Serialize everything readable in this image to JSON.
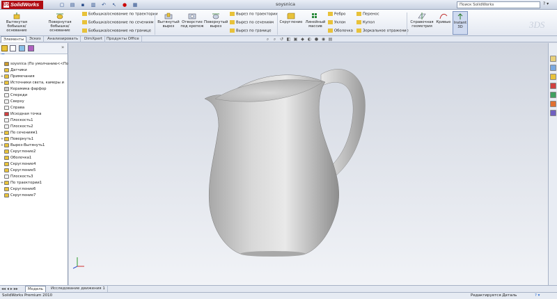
{
  "app": {
    "logo_text": "SolidWorks",
    "doc_title": "soysnica",
    "search_placeholder": "Поиск SolidWorks"
  },
  "ribbon": {
    "extrude_boss": "Вытянутая бобышка/основание",
    "revolve_boss": "Повернутая бобышка/основание",
    "sweep_boss": "Бобышка/основание по траектории",
    "loft_boss": "Бобышка/основание по сечениям",
    "boundary_boss": "Бобышка/основание на границе",
    "extrude_cut": "Вытянутый вырез",
    "hole_wizard": "Отверстие под крепеж",
    "revolve_cut": "Повернутый вырез",
    "sweep_cut": "Вырез по траектории",
    "loft_cut": "Вырез по сечениям",
    "boundary_cut": "Вырез по границе",
    "fillet": "Скругление",
    "linear_pattern": "Линейный массив",
    "rib": "Ребро",
    "draft": "Уклон",
    "shell": "Оболочка",
    "wrap": "Перенос",
    "dome": "Купол",
    "mirror": "Зеркальное отражение",
    "ref_geometry": "Справочная геометрия",
    "curves": "Кривые",
    "instant3d": "Instant 3D"
  },
  "tabs": [
    "Элементы",
    "Эскиз",
    "Анализировать",
    "DimXpert",
    "Продукты Office"
  ],
  "tree": [
    {
      "label": "soysnica  (По умолчанию<<По",
      "exp": "",
      "color": "#c99a2e"
    },
    {
      "label": "Датчики",
      "exp": "",
      "color": "#e8c23a"
    },
    {
      "label": "Примечания",
      "exp": "+",
      "color": "#e8c23a"
    },
    {
      "label": "Источники света, камеры и",
      "exp": "+",
      "color": "#e8c23a"
    },
    {
      "label": "Керамика фарфор",
      "exp": "",
      "color": "#c8c8c8"
    },
    {
      "label": "Спереди",
      "exp": "",
      "color": "#f2f2f2"
    },
    {
      "label": "Сверху",
      "exp": "",
      "color": "#f2f2f2"
    },
    {
      "label": "Справа",
      "exp": "",
      "color": "#f2f2f2"
    },
    {
      "label": "Исходная точка",
      "exp": "",
      "color": "#d04040"
    },
    {
      "label": "Плоскость1",
      "exp": "",
      "color": "#f2f2f2"
    },
    {
      "label": "Плоскость2",
      "exp": "",
      "color": "#f2f2f2"
    },
    {
      "label": "По сечениям1",
      "exp": "+",
      "color": "#e8c23a"
    },
    {
      "label": "Повернуть1",
      "exp": "+",
      "color": "#e8c23a"
    },
    {
      "label": "Вырез-Вытянуть1",
      "exp": "+",
      "color": "#e8c23a"
    },
    {
      "label": "Скругление2",
      "exp": "",
      "color": "#e8c23a"
    },
    {
      "label": "Оболочка1",
      "exp": "",
      "color": "#e8c23a"
    },
    {
      "label": "Скругление4",
      "exp": "",
      "color": "#e8c23a"
    },
    {
      "label": "Скругление5",
      "exp": "",
      "color": "#e8c23a"
    },
    {
      "label": "Плоскость3",
      "exp": "",
      "color": "#f2f2f2"
    },
    {
      "label": "По траектории1",
      "exp": "+",
      "color": "#e8c23a"
    },
    {
      "label": "Скругление6",
      "exp": "",
      "color": "#e8c23a"
    },
    {
      "label": "Скругление7",
      "exp": "",
      "color": "#e8c23a"
    }
  ],
  "bottom_tabs": {
    "model": "Модель",
    "motion": "Исследование движения 1"
  },
  "status": {
    "left": "SolidWorks Premium 2010",
    "right": "Редактируется Деталь"
  }
}
